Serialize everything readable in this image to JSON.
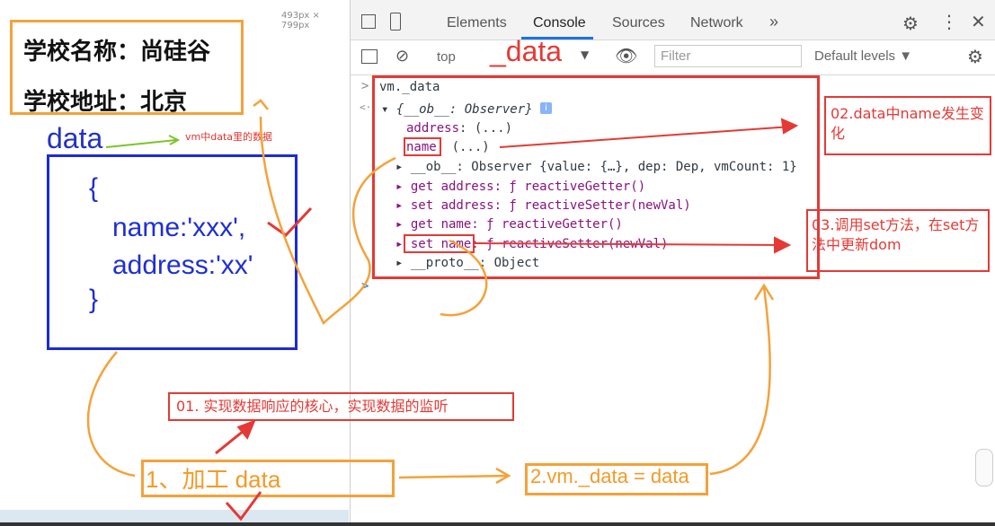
{
  "left": {
    "size_badge": "493px × 799px",
    "school_name": "学校名称：尚硅谷",
    "school_address": "学校地址：北京",
    "data_label": "data",
    "data_note": "vm中data里的数据",
    "code": [
      "{",
      "name:'xxx',",
      "address:'xx'",
      "}"
    ]
  },
  "devtools": {
    "tabs": [
      "Elements",
      "Console",
      "Sources",
      "Network",
      "»"
    ],
    "toolbar": {
      "context": "top",
      "filter_placeholder": "Filter",
      "levels": "Default levels ▼",
      "handwritten_data": "_data"
    },
    "console": {
      "input": "vm._data",
      "object_header": "{__ob__: Observer}",
      "address_prop": "address",
      "address_val": ": (...)",
      "name_prop": "name",
      "name_val": ": (...)",
      "ob_line": "__ob__: Observer {value: {…}, dep: Dep, vmCount: 1}",
      "get_address": "get address: ƒ reactiveGetter()",
      "set_address": "set address: ƒ reactiveSetter(newVal)",
      "get_name": "get name: ƒ reactiveGetter()",
      "set_name": "set name: ƒ reactiveSetter(newVal)",
      "proto": "__proto__: Object",
      "prompt": ">",
      "result_arrow": "<·",
      "next_prompt": ">"
    }
  },
  "annotations": {
    "note02": "02.data中name发生变化",
    "note03": "03.调用set方法，在set方法中更新dom",
    "note01": "01. 实现数据响应的核心，实现数据的监听",
    "step1": "1、加工 data",
    "step2": "2.vm._data = data"
  },
  "colors": {
    "red": "#e53935",
    "orange": "#f4a23a",
    "blue": "#1c2bd3",
    "purple": "#881280"
  }
}
